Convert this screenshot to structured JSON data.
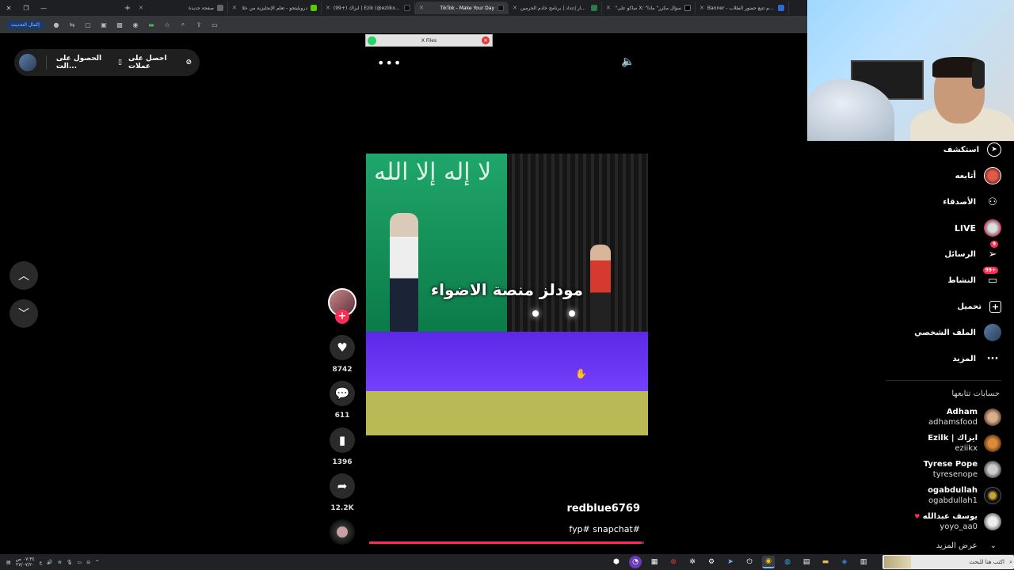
{
  "browser": {
    "tabs": [
      {
        "title": "صفحة جديدة",
        "active": false
      },
      {
        "title": "دروبليتجو - تعلم الإنجليزية من خلا",
        "active": false
      },
      {
        "title": "(99+) ايزاك | Ezik (@eziikx) | Tok",
        "active": false
      },
      {
        "title": "TikTok - Make Your Day",
        "active": true
      },
      {
        "title": "مسار إعداد | برنامج خادم الحرمين",
        "active": false
      },
      {
        "title": "\"ساكو على X: \"سؤال مكرر\" ماذا",
        "active": false
      },
      {
        "title": "Banner - نظام تتبع حضور الطلاب",
        "active": false
      }
    ],
    "update_button": "إكمال التحديث",
    "pip_title": "X Files"
  },
  "top_pill": {
    "label_get_app": "الحصول على الت...",
    "label_coins": "احصل على عملات"
  },
  "video": {
    "caption": "مودلز منصة الاضواء",
    "flag_text": "لا إله إلا الله",
    "username": "redblue6769",
    "tags": "fyp# snapchat#",
    "progress": 0.99
  },
  "actions": {
    "likes": "8742",
    "comments": "611",
    "saves": "1396",
    "shares": "12.2K"
  },
  "sidebar": {
    "items": [
      {
        "label": "استكشف",
        "icon": "compass-icon",
        "glyph": "⊘"
      },
      {
        "label": "أتابعه",
        "icon": "following-avatar-icon",
        "glyph": ""
      },
      {
        "label": "الأصدقاء",
        "icon": "friends-icon",
        "glyph": "👥"
      },
      {
        "label": "LIVE",
        "icon": "live-avatar-icon",
        "glyph": ""
      },
      {
        "label": "الرسائل",
        "icon": "send-icon",
        "glyph": "➢",
        "badge": "9"
      },
      {
        "label": "النشاط",
        "icon": "inbox-icon",
        "glyph": "▭",
        "badge": "99+"
      },
      {
        "label": "تحميل",
        "icon": "upload-icon",
        "glyph": "⊞"
      },
      {
        "label": "الملف الشخصي",
        "icon": "profile-avatar-icon",
        "glyph": ""
      },
      {
        "label": "المزيد",
        "icon": "more-icon",
        "glyph": "···"
      }
    ],
    "following_heading": "حسابات تتابعها",
    "accounts": [
      {
        "name": "Adham",
        "handle": "adhamsfood"
      },
      {
        "name": "Ezilk | ايزاك",
        "handle": "eziikx"
      },
      {
        "name": "Tyrese Pope",
        "handle": "tyresenope"
      },
      {
        "name": "ogabdullah",
        "handle": "ogabdullah1"
      },
      {
        "name": "يوسف عبدالله",
        "handle": "yoyo_aa0"
      }
    ],
    "see_more": "عرض المزيد"
  },
  "taskbar": {
    "clock_time": "٠٧:٣٤ ص",
    "clock_date": "٢٧/٠٧/٢٠",
    "lang": "ع",
    "search_placeholder": "اكتب هنا للبحث"
  },
  "colors": {
    "accent": "#fe2c55",
    "background": "#000000",
    "panel": "#2a2a2a"
  }
}
